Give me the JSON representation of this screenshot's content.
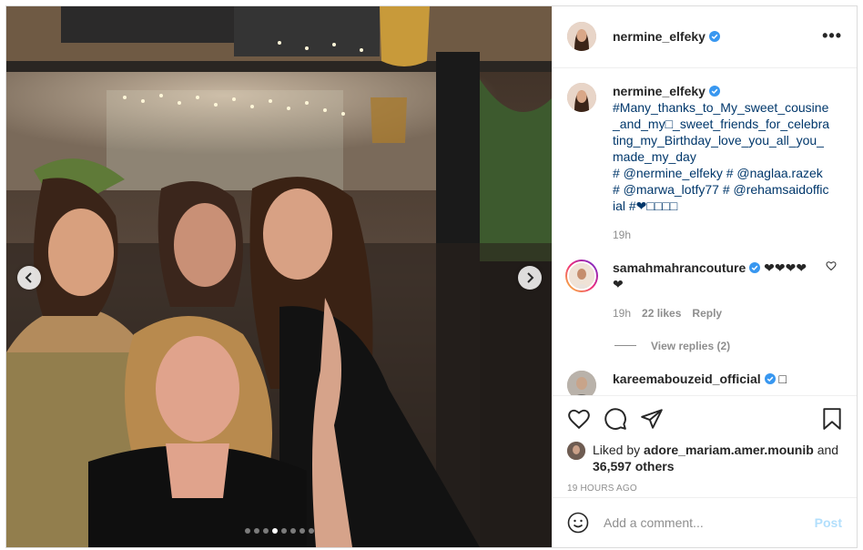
{
  "post": {
    "author": "nermine_elfeky",
    "more_label": "•••",
    "carousel": {
      "slide_count": 8,
      "active_index": 3
    }
  },
  "caption": {
    "username": "nermine_elfeky",
    "text": "#Many_thanks_to_My_sweet_cousine_and_my□_sweet_friends_for_celebrating_my_Birthday_love_you_all_you_made_my_day",
    "tags_line": "# @nermine_elfeky # @naglaa.razek # @marwa_lotfy77 # @rehamsaidofficial #❤□□□□",
    "time": "19h"
  },
  "comments": [
    {
      "username": "samahmahrancouture",
      "text": "❤❤❤❤ ❤",
      "time": "19h",
      "likes": "22 likes",
      "reply_label": "Reply",
      "view_replies": "View replies (2)"
    },
    {
      "username": "kareemabouzeid_official",
      "text": "□"
    }
  ],
  "likes": {
    "prefix": "Liked by",
    "user": "adore_mariam.amer.mounib",
    "and": "and",
    "others": "36,597 others"
  },
  "timestamp": "19 HOURS AGO",
  "add_comment": {
    "placeholder": "Add a comment...",
    "post_label": "Post"
  },
  "colors": {
    "verified": "#3897f0",
    "link": "#00376b",
    "post_disabled": "#b2dffc"
  }
}
